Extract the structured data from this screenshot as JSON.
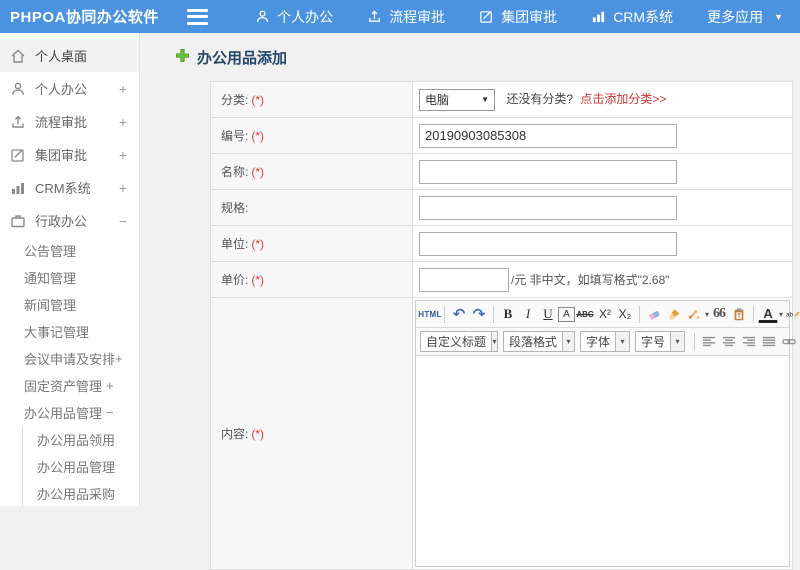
{
  "topbar": {
    "logo": "PHPOA协同办公软件",
    "nav": [
      {
        "icon": "user",
        "label": "个人办公"
      },
      {
        "icon": "flow",
        "label": "流程审批"
      },
      {
        "icon": "edit",
        "label": "集团审批"
      },
      {
        "icon": "chart",
        "label": "CRM系统"
      },
      {
        "icon": "",
        "label": "更多应用",
        "caret": true
      }
    ]
  },
  "sidebar": {
    "items": [
      {
        "icon": "home",
        "label": "个人桌面",
        "level": 0,
        "active": true
      },
      {
        "icon": "user",
        "label": "个人办公",
        "level": 0,
        "expand": "+"
      },
      {
        "icon": "flow",
        "label": "流程审批",
        "level": 0,
        "expand": "+"
      },
      {
        "icon": "edit",
        "label": "集团审批",
        "level": 0,
        "expand": "+"
      },
      {
        "icon": "chart",
        "label": "CRM系统",
        "level": 0,
        "expand": "+"
      },
      {
        "icon": "briefcase",
        "label": "行政办公",
        "level": 0,
        "expand": "−"
      },
      {
        "label": "公告管理",
        "level": 1
      },
      {
        "label": "通知管理",
        "level": 1
      },
      {
        "label": "新闻管理",
        "level": 1
      },
      {
        "label": "大事记管理",
        "level": 1
      },
      {
        "label": "会议申请及安排",
        "level": 1,
        "expand": "+",
        "tight": true
      },
      {
        "label": "固定资产管理",
        "level": 1,
        "expand": "+"
      },
      {
        "label": "办公用品管理",
        "level": 1,
        "expand": "−"
      },
      {
        "label": "办公用品领用",
        "level": 2
      },
      {
        "label": "办公用品管理",
        "level": 2
      },
      {
        "label": "办公用品采购",
        "level": 2
      }
    ]
  },
  "main": {
    "title": "办公用品添加",
    "form": {
      "category": {
        "label": "分类:",
        "required": "(*)",
        "select_value": "电脑",
        "hint": "还没有分类?",
        "link": "点击添加分类>>"
      },
      "code": {
        "label": "编号:",
        "required": "(*)",
        "value": "20190903085308"
      },
      "name": {
        "label": "名称:",
        "required": "(*)",
        "value": ""
      },
      "spec": {
        "label": "规格:",
        "value": ""
      },
      "unit": {
        "label": "单位:",
        "required": "(*)",
        "value": ""
      },
      "price": {
        "label": "单价:",
        "required": "(*)",
        "value": "",
        "suffix": "/元 非中文，如填写格式\"2.68\""
      },
      "content": {
        "label": "内容:",
        "required": "(*)"
      }
    },
    "editor": {
      "toolbar_row1": [
        {
          "t": "btn",
          "name": "html-source-button",
          "glyph": "HTML",
          "cls": "html"
        },
        {
          "t": "sep"
        },
        {
          "t": "btn",
          "name": "undo-icon",
          "glyph": "↶",
          "cls": "blue"
        },
        {
          "t": "btn",
          "name": "redo-icon",
          "glyph": "↷",
          "cls": "blue"
        },
        {
          "t": "sep"
        },
        {
          "t": "btn",
          "name": "bold-icon",
          "glyph": "B",
          "cls": "b"
        },
        {
          "t": "btn",
          "name": "italic-icon",
          "glyph": "I",
          "cls": "i"
        },
        {
          "t": "btn",
          "name": "underline-icon",
          "glyph": "U",
          "cls": "u"
        },
        {
          "t": "btn",
          "name": "remove-format-icon",
          "glyph": "A",
          "cls": "box"
        },
        {
          "t": "btn",
          "name": "strikethrough-icon",
          "glyph": "ABC",
          "cls": "strike"
        },
        {
          "t": "btn",
          "name": "superscript-icon",
          "glyph": "X²"
        },
        {
          "t": "btn",
          "name": "subscript-icon",
          "glyph": "X₂"
        },
        {
          "t": "sep"
        },
        {
          "t": "svg",
          "name": "eraser-icon",
          "icon": "eraser"
        },
        {
          "t": "svg",
          "name": "clean-brush-icon",
          "icon": "brush"
        },
        {
          "t": "svg",
          "name": "format-painter-icon",
          "icon": "painter",
          "caret": true
        },
        {
          "t": "btn",
          "name": "blockquote-icon",
          "glyph": "66",
          "cls": "quote"
        },
        {
          "t": "svg",
          "name": "paste-icon",
          "icon": "paste"
        },
        {
          "t": "sep"
        },
        {
          "t": "btn",
          "name": "font-color-icon",
          "glyph": "A",
          "cls": "fontA",
          "caret": true
        },
        {
          "t": "svg",
          "name": "highlight-color-icon",
          "icon": "highlight",
          "caret": true
        }
      ],
      "toolbar_selects": [
        {
          "name": "custom-title-select",
          "label": "自定义标题"
        },
        {
          "name": "paragraph-format-select",
          "label": "段落格式"
        },
        {
          "name": "font-family-select",
          "label": "字体"
        },
        {
          "name": "font-size-select",
          "label": "字号"
        }
      ],
      "toolbar_row2_icons": [
        {
          "name": "align-left-icon",
          "icon": "alignL"
        },
        {
          "name": "align-center-icon",
          "icon": "alignC"
        },
        {
          "name": "align-right-icon",
          "icon": "alignR"
        },
        {
          "name": "justify-icon",
          "icon": "alignJ"
        },
        {
          "name": "link-icon",
          "icon": "link"
        }
      ]
    }
  },
  "colors": {
    "topbar_blue": "#4b93e1",
    "title_navy": "#25476a",
    "required_red": "#e23b3b",
    "link_red": "#cc3333",
    "plus_green": "#6cbf3a"
  }
}
